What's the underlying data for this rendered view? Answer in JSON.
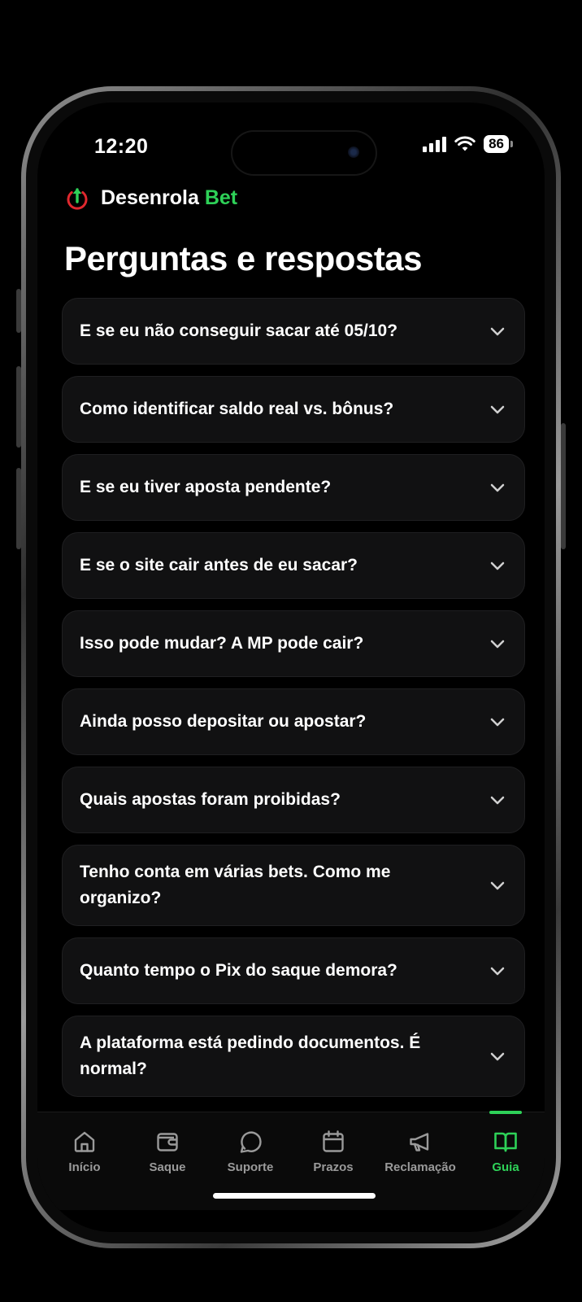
{
  "status_bar": {
    "time": "12:20",
    "battery": "86"
  },
  "brand": {
    "name": "Desenrola",
    "accent": "Bet",
    "accent_color": "#2ed158"
  },
  "page": {
    "title": "Perguntas e respostas"
  },
  "faq": [
    {
      "question": "E se eu não conseguir sacar até 05/10?"
    },
    {
      "question": "Como identificar saldo real vs. bônus?"
    },
    {
      "question": "E se eu tiver aposta pendente?"
    },
    {
      "question": "E se o site cair antes de eu sacar?"
    },
    {
      "question": "Isso pode mudar? A MP pode cair?"
    },
    {
      "question": "Ainda posso depositar ou apostar?"
    },
    {
      "question": "Quais apostas foram proibidas?"
    },
    {
      "question": "Tenho conta em várias bets. Como me organizo?"
    },
    {
      "question": "Quanto tempo o Pix do saque demora?"
    },
    {
      "question": "A plataforma está pedindo documentos. É normal?"
    }
  ],
  "tabs": [
    {
      "label": "Início",
      "icon": "home-icon"
    },
    {
      "label": "Saque",
      "icon": "wallet-icon"
    },
    {
      "label": "Suporte",
      "icon": "chat-bubble-icon"
    },
    {
      "label": "Prazos",
      "icon": "calendar-icon"
    },
    {
      "label": "Reclamação",
      "icon": "megaphone-icon"
    },
    {
      "label": "Guia",
      "icon": "book-icon",
      "active": true
    }
  ]
}
